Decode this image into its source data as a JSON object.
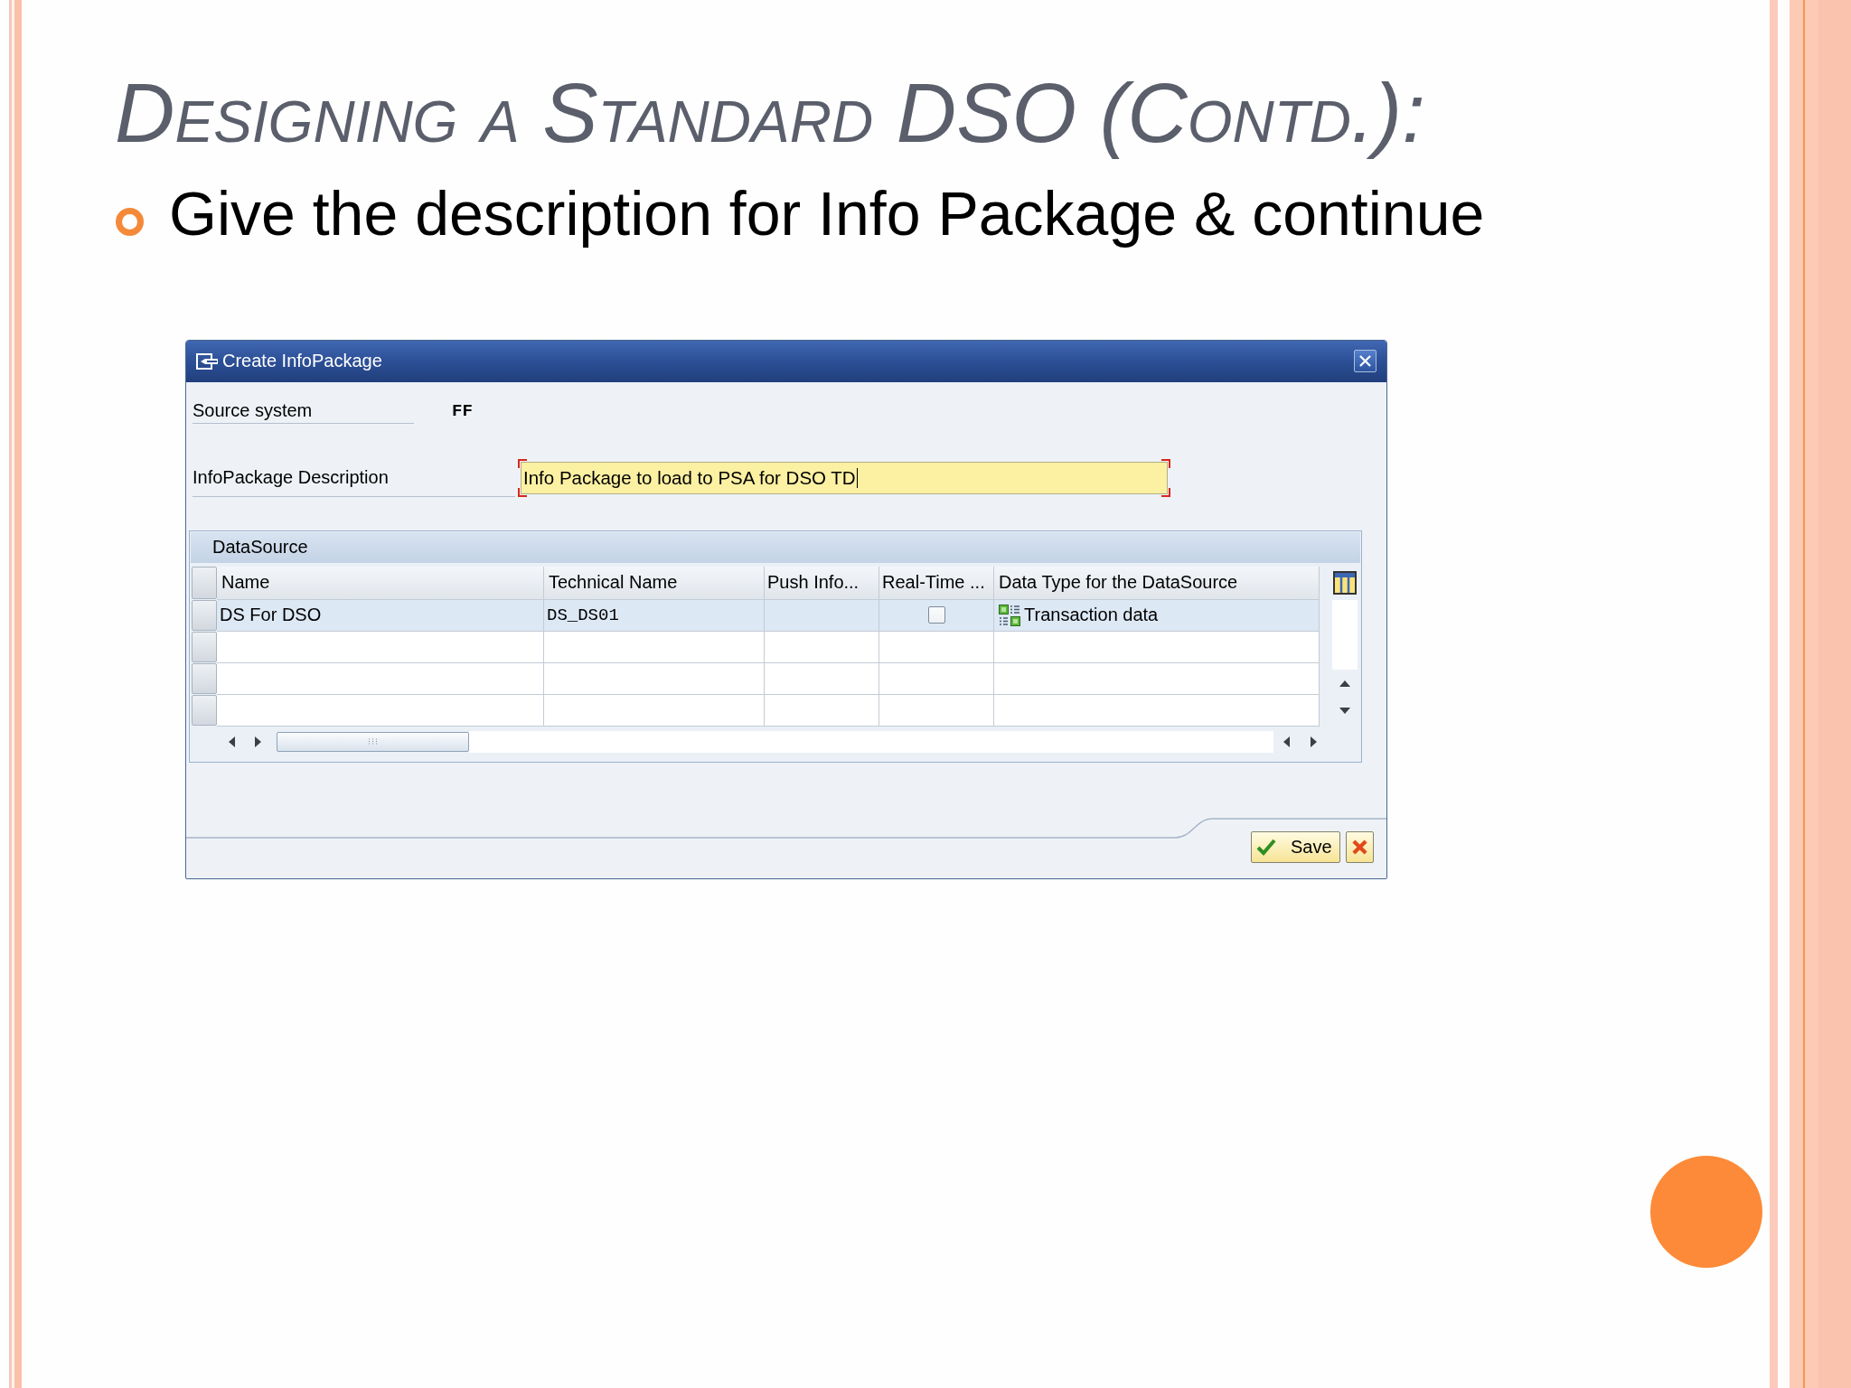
{
  "slide": {
    "title": "Designing a Standard DSO (Contd.):",
    "bullets": [
      "Give the description for Info Package & continue"
    ]
  },
  "dialog": {
    "title": "Create InfoPackage",
    "fields": [
      {
        "label": "Source system",
        "kind": "display",
        "value": "FF"
      },
      {
        "label": "InfoPackage Description",
        "kind": "input",
        "value": "Info Package to load to PSA for DSO TD",
        "required": true,
        "focused": true
      }
    ],
    "group": {
      "title": "DataSource",
      "columns": [
        "Name",
        "Technical Name",
        "Push Info...",
        "Real-Time ...",
        "Data Type for the DataSource"
      ],
      "rows": [
        {
          "name": "DS For DSO",
          "technical_name": "DS_DS01",
          "real_time": false,
          "data_type": "Transaction data"
        }
      ]
    },
    "buttons": [
      {
        "kind": "save",
        "label": "Save"
      },
      {
        "kind": "cancel"
      }
    ]
  }
}
